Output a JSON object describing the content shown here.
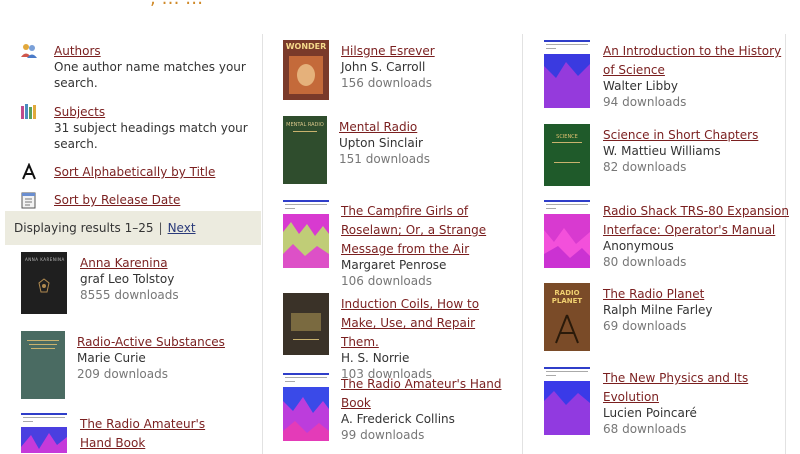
{
  "header": {
    "title_partial": ", … …"
  },
  "left": {
    "menu": [
      {
        "icon": "authors-icon",
        "label": "Authors",
        "desc": "One author name matches your search."
      },
      {
        "icon": "subjects-icon",
        "label": "Subjects",
        "desc": "31 subject headings match your search."
      },
      {
        "icon": "sort-alpha-icon",
        "label": "Sort Alphabetically by Title",
        "desc": ""
      },
      {
        "icon": "sort-date-icon",
        "label": "Sort by Release Date",
        "desc": ""
      }
    ],
    "results": {
      "text": "Displaying results 1–25",
      "sep": "|",
      "next": "Next"
    },
    "books": [
      {
        "title": "Anna Karenina",
        "author": "graf Leo Tolstoy",
        "downloads": "8555 downloads"
      },
      {
        "title": "Radio-Active Substances",
        "author": "Marie Curie",
        "downloads": "209 downloads"
      },
      {
        "title": "The Radio Amateur's Hand Book",
        "author": "",
        "downloads": ""
      }
    ]
  },
  "middle": {
    "books": [
      {
        "title": "Hilsgne Esrever",
        "author": "John S. Carroll",
        "downloads": "156 downloads"
      },
      {
        "title": "Mental Radio",
        "author": "Upton Sinclair",
        "downloads": "151 downloads"
      },
      {
        "title": "The Campfire Girls of Roselawn; Or, a Strange Message from the Air",
        "author": "Margaret Penrose",
        "downloads": "106 downloads"
      },
      {
        "title": "Induction Coils, How to Make, Use, and Repair Them.",
        "author": "H. S. Norrie",
        "downloads": "103 downloads"
      },
      {
        "title": "The Radio Amateur's Hand Book",
        "author": "A. Frederick Collins",
        "downloads": "99 downloads"
      }
    ]
  },
  "right": {
    "books": [
      {
        "title": "An Introduction to the History of Science",
        "author": "Walter Libby",
        "downloads": "94 downloads"
      },
      {
        "title": "Science in Short Chapters",
        "author": "W. Mattieu Williams",
        "downloads": "82 downloads"
      },
      {
        "title": "Radio Shack TRS-80 Expansion Interface: Operator's Manual",
        "author": "Anonymous",
        "downloads": "80 downloads"
      },
      {
        "title": "The Radio Planet",
        "author": "Ralph Milne Farley",
        "downloads": "69 downloads"
      },
      {
        "title": "The New Physics and Its Evolution",
        "author": "Lucien Poincaré",
        "downloads": "68 downloads"
      }
    ]
  },
  "covers": {
    "anna": {
      "text": "ANNA KARENINA"
    },
    "wonder": {
      "text": "WONDER"
    },
    "mental": {
      "text": "MENTAL RADIO"
    },
    "science": {
      "text": "SCIENCE"
    },
    "radio_planet": {
      "text": "RADIO PLANET"
    }
  },
  "colors": {
    "link": "#7a1f1f",
    "next": "#2a3a7a",
    "bar": "#ecebdf",
    "accent": "#d08a2a"
  }
}
